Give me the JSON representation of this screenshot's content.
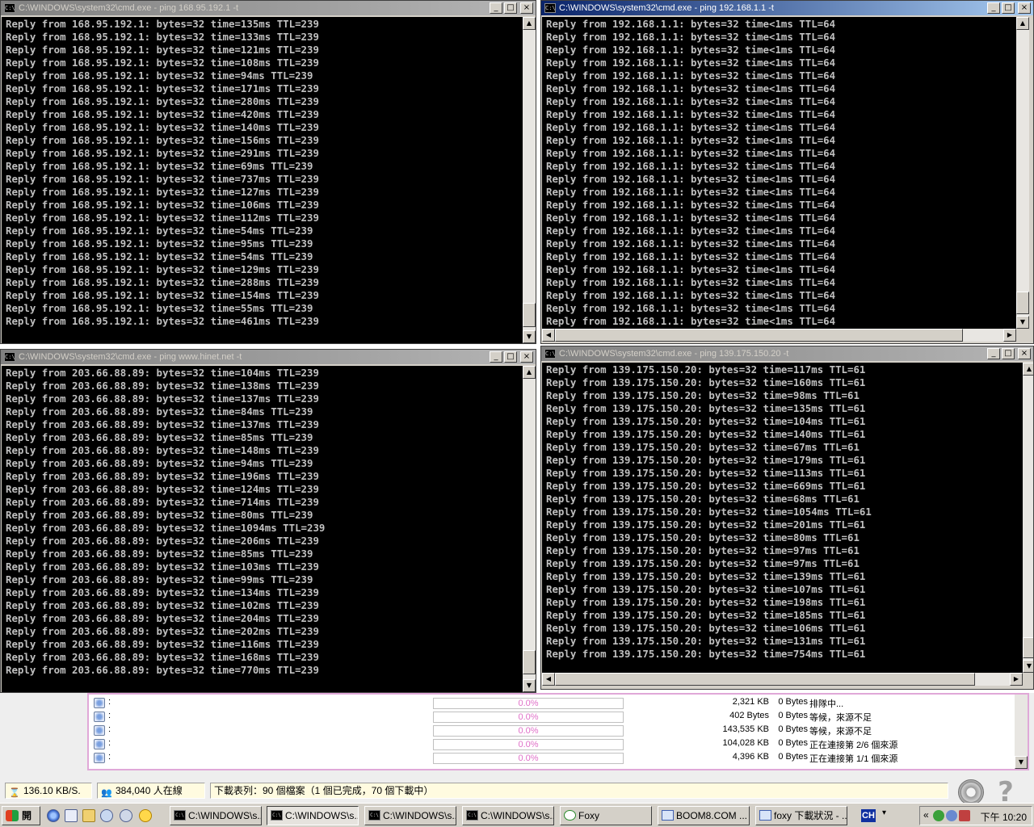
{
  "windows": [
    {
      "id": "cmd1",
      "title": "C:\\WINDOWS\\system32\\cmd.exe - ping 168.95.192.1 -t",
      "active": false,
      "lines": [
        "Reply from 168.95.192.1: bytes=32 time=135ms TTL=239",
        "Reply from 168.95.192.1: bytes=32 time=133ms TTL=239",
        "Reply from 168.95.192.1: bytes=32 time=121ms TTL=239",
        "Reply from 168.95.192.1: bytes=32 time=108ms TTL=239",
        "Reply from 168.95.192.1: bytes=32 time=94ms TTL=239",
        "Reply from 168.95.192.1: bytes=32 time=171ms TTL=239",
        "Reply from 168.95.192.1: bytes=32 time=280ms TTL=239",
        "Reply from 168.95.192.1: bytes=32 time=420ms TTL=239",
        "Reply from 168.95.192.1: bytes=32 time=140ms TTL=239",
        "Reply from 168.95.192.1: bytes=32 time=156ms TTL=239",
        "Reply from 168.95.192.1: bytes=32 time=291ms TTL=239",
        "Reply from 168.95.192.1: bytes=32 time=69ms TTL=239",
        "Reply from 168.95.192.1: bytes=32 time=737ms TTL=239",
        "Reply from 168.95.192.1: bytes=32 time=127ms TTL=239",
        "Reply from 168.95.192.1: bytes=32 time=106ms TTL=239",
        "Reply from 168.95.192.1: bytes=32 time=112ms TTL=239",
        "Reply from 168.95.192.1: bytes=32 time=54ms TTL=239",
        "Reply from 168.95.192.1: bytes=32 time=95ms TTL=239",
        "Reply from 168.95.192.1: bytes=32 time=54ms TTL=239",
        "Reply from 168.95.192.1: bytes=32 time=129ms TTL=239",
        "Reply from 168.95.192.1: bytes=32 time=288ms TTL=239",
        "Reply from 168.95.192.1: bytes=32 time=154ms TTL=239",
        "Reply from 168.95.192.1: bytes=32 time=55ms TTL=239",
        "Reply from 168.95.192.1: bytes=32 time=461ms TTL=239"
      ]
    },
    {
      "id": "cmd2",
      "title": "C:\\WINDOWS\\system32\\cmd.exe - ping 192.168.1.1 -t",
      "active": true,
      "lines": [
        "Reply from 192.168.1.1: bytes=32 time<1ms TTL=64",
        "Reply from 192.168.1.1: bytes=32 time<1ms TTL=64",
        "Reply from 192.168.1.1: bytes=32 time<1ms TTL=64",
        "Reply from 192.168.1.1: bytes=32 time<1ms TTL=64",
        "Reply from 192.168.1.1: bytes=32 time<1ms TTL=64",
        "Reply from 192.168.1.1: bytes=32 time<1ms TTL=64",
        "Reply from 192.168.1.1: bytes=32 time<1ms TTL=64",
        "Reply from 192.168.1.1: bytes=32 time<1ms TTL=64",
        "Reply from 192.168.1.1: bytes=32 time<1ms TTL=64",
        "Reply from 192.168.1.1: bytes=32 time<1ms TTL=64",
        "Reply from 192.168.1.1: bytes=32 time<1ms TTL=64",
        "Reply from 192.168.1.1: bytes=32 time<1ms TTL=64",
        "Reply from 192.168.1.1: bytes=32 time<1ms TTL=64",
        "Reply from 192.168.1.1: bytes=32 time<1ms TTL=64",
        "Reply from 192.168.1.1: bytes=32 time<1ms TTL=64",
        "Reply from 192.168.1.1: bytes=32 time<1ms TTL=64",
        "Reply from 192.168.1.1: bytes=32 time<1ms TTL=64",
        "Reply from 192.168.1.1: bytes=32 time<1ms TTL=64",
        "Reply from 192.168.1.1: bytes=32 time<1ms TTL=64",
        "Reply from 192.168.1.1: bytes=32 time<1ms TTL=64",
        "Reply from 192.168.1.1: bytes=32 time<1ms TTL=64",
        "Reply from 192.168.1.1: bytes=32 time<1ms TTL=64",
        "Reply from 192.168.1.1: bytes=32 time<1ms TTL=64",
        "Reply from 192.168.1.1: bytes=32 time<1ms TTL=64"
      ]
    },
    {
      "id": "cmd3",
      "title": "C:\\WINDOWS\\system32\\cmd.exe - ping www.hinet.net -t",
      "active": false,
      "lines": [
        "Reply from 203.66.88.89: bytes=32 time=104ms TTL=239",
        "Reply from 203.66.88.89: bytes=32 time=138ms TTL=239",
        "Reply from 203.66.88.89: bytes=32 time=137ms TTL=239",
        "Reply from 203.66.88.89: bytes=32 time=84ms TTL=239",
        "Reply from 203.66.88.89: bytes=32 time=137ms TTL=239",
        "Reply from 203.66.88.89: bytes=32 time=85ms TTL=239",
        "Reply from 203.66.88.89: bytes=32 time=148ms TTL=239",
        "Reply from 203.66.88.89: bytes=32 time=94ms TTL=239",
        "Reply from 203.66.88.89: bytes=32 time=196ms TTL=239",
        "Reply from 203.66.88.89: bytes=32 time=124ms TTL=239",
        "Reply from 203.66.88.89: bytes=32 time=714ms TTL=239",
        "Reply from 203.66.88.89: bytes=32 time=80ms TTL=239",
        "Reply from 203.66.88.89: bytes=32 time=1094ms TTL=239",
        "Reply from 203.66.88.89: bytes=32 time=206ms TTL=239",
        "Reply from 203.66.88.89: bytes=32 time=85ms TTL=239",
        "Reply from 203.66.88.89: bytes=32 time=103ms TTL=239",
        "Reply from 203.66.88.89: bytes=32 time=99ms TTL=239",
        "Reply from 203.66.88.89: bytes=32 time=134ms TTL=239",
        "Reply from 203.66.88.89: bytes=32 time=102ms TTL=239",
        "Reply from 203.66.88.89: bytes=32 time=204ms TTL=239",
        "Reply from 203.66.88.89: bytes=32 time=202ms TTL=239",
        "Reply from 203.66.88.89: bytes=32 time=116ms TTL=239",
        "Reply from 203.66.88.89: bytes=32 time=168ms TTL=239",
        "Reply from 203.66.88.89: bytes=32 time=770ms TTL=239"
      ]
    },
    {
      "id": "cmd4",
      "title": "C:\\WINDOWS\\system32\\cmd.exe - ping 139.175.150.20 -t",
      "active": false,
      "lines": [
        "Reply from 139.175.150.20: bytes=32 time=117ms TTL=61",
        "Reply from 139.175.150.20: bytes=32 time=160ms TTL=61",
        "Reply from 139.175.150.20: bytes=32 time=98ms TTL=61",
        "Reply from 139.175.150.20: bytes=32 time=135ms TTL=61",
        "Reply from 139.175.150.20: bytes=32 time=104ms TTL=61",
        "Reply from 139.175.150.20: bytes=32 time=140ms TTL=61",
        "Reply from 139.175.150.20: bytes=32 time=67ms TTL=61",
        "Reply from 139.175.150.20: bytes=32 time=179ms TTL=61",
        "Reply from 139.175.150.20: bytes=32 time=113ms TTL=61",
        "Reply from 139.175.150.20: bytes=32 time=669ms TTL=61",
        "Reply from 139.175.150.20: bytes=32 time=68ms TTL=61",
        "Reply from 139.175.150.20: bytes=32 time=1054ms TTL=61",
        "Reply from 139.175.150.20: bytes=32 time=201ms TTL=61",
        "Reply from 139.175.150.20: bytes=32 time=80ms TTL=61",
        "Reply from 139.175.150.20: bytes=32 time=97ms TTL=61",
        "Reply from 139.175.150.20: bytes=32 time=97ms TTL=61",
        "Reply from 139.175.150.20: bytes=32 time=139ms TTL=61",
        "Reply from 139.175.150.20: bytes=32 time=107ms TTL=61",
        "Reply from 139.175.150.20: bytes=32 time=198ms TTL=61",
        "Reply from 139.175.150.20: bytes=32 time=185ms TTL=61",
        "Reply from 139.175.150.20: bytes=32 time=106ms TTL=61",
        "Reply from 139.175.150.20: bytes=32 time=131ms TTL=61",
        "Reply from 139.175.150.20: bytes=32 time=754ms TTL=61"
      ]
    }
  ],
  "window_buttons": {
    "minimize": "_",
    "maximize": "□",
    "close": "×"
  },
  "scroll_arrows": {
    "up": "▲",
    "down": "▼",
    "left": "◀",
    "right": "▶"
  },
  "downloads": {
    "rows": [
      {
        "name": ":",
        "progress": "0.0%",
        "size": "2,321 KB",
        "speed": "0 Bytes",
        "status": "排隊中..."
      },
      {
        "name": ":",
        "progress": "0.0%",
        "size": "402 Bytes",
        "speed": "0 Bytes",
        "status": "等候，來源不足"
      },
      {
        "name": ":",
        "progress": "0.0%",
        "size": "143,535 KB",
        "speed": "0 Bytes",
        "status": "等候，來源不足"
      },
      {
        "name": ":",
        "progress": "0.0%",
        "size": "104,028 KB",
        "speed": "0 Bytes",
        "status": "正在連接第 2/6 個來源"
      },
      {
        "name": ":",
        "progress": "0.0%",
        "size": "4,396 KB",
        "speed": "0 Bytes",
        "status": "正在連接第 1/1 個來源"
      }
    ]
  },
  "statusbar": {
    "speed": "136.10 KB/S.",
    "online": "384,040 人在線",
    "download_summary": "下載表列：90 個檔案（1 個已完成，70 個下載中）"
  },
  "taskbar": {
    "start_label": "開始",
    "tasks": [
      {
        "label": "C:\\WINDOWS\\s...",
        "icon": "cmd-icon",
        "pressed": false
      },
      {
        "label": "C:\\WINDOWS\\s...",
        "icon": "cmd-icon",
        "pressed": true
      },
      {
        "label": "C:\\WINDOWS\\s...",
        "icon": "cmd-icon",
        "pressed": false
      },
      {
        "label": "C:\\WINDOWS\\s...",
        "icon": "cmd-icon",
        "pressed": false
      },
      {
        "label": "Foxy",
        "icon": "foxy-icon",
        "pressed": false
      },
      {
        "label": "BOOM8.COM ...",
        "icon": "ie-icon",
        "pressed": false
      },
      {
        "label": "foxy 下載狀況 - ...",
        "icon": "ie-icon",
        "pressed": false
      }
    ],
    "ime_label": "CH",
    "clock": "下午 10:20"
  },
  "colors": {
    "console_bg": "#000000",
    "console_fg": "#c0c0c0",
    "active_title": "#0a246a",
    "inactive_title": "#808080",
    "progress_text": "#e070c8"
  }
}
